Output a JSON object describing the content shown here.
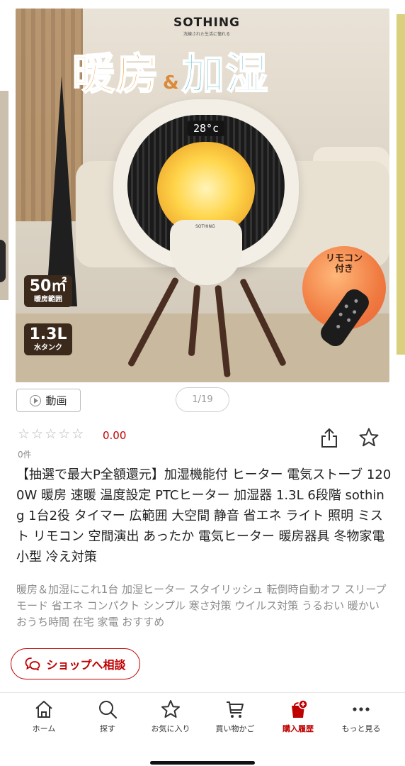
{
  "carousel": {
    "brand": "SOTHING",
    "brand_tagline": "洗練された生活に憧れる",
    "headline_a": "暖房",
    "headline_amp": "&",
    "headline_b": "加湿",
    "display_temp": "28°c",
    "heater_logo": "SOTHING",
    "badge_area_big": "50㎡",
    "badge_area_small": "暖房範囲",
    "badge_tank_big": "1.3L",
    "badge_tank_small": "水タンク",
    "remote_label_line1": "リモコン",
    "remote_label_line2": "付き",
    "video_label": "動画",
    "pager": "1/19"
  },
  "rating": {
    "stars_filled": 0,
    "stars_total": 5,
    "value": "0.00",
    "count": "0件"
  },
  "product": {
    "title": "【抽選で最大P全額還元】加湿機能付 ヒーター 電気ストーブ 1200W 暖房 速暖 温度設定 PTCヒーター 加湿器 1.3L 6段階 sothing 1台2役 タイマー 広範囲 大空間 静音 省エネ ライト 照明 ミスト リモコン 空間演出 あったか 電気ヒーター 暖房器具 冬物家電 小型 冷え対策",
    "description": "暖房＆加湿にこれ1台 加湿ヒーター スタイリッシュ 転倒時自動オフ スリープモード 省エネ コンパクト シンプル 寒さ対策 ウイルス対策 うるおい 暖かい おうち時間 在宅 家電 おすすめ"
  },
  "consult": {
    "label": "ショップへ相談"
  },
  "nav": {
    "items": [
      {
        "label": "ホーム",
        "icon": "home-icon"
      },
      {
        "label": "探す",
        "icon": "search-icon"
      },
      {
        "label": "お気に入り",
        "icon": "star-icon"
      },
      {
        "label": "買い物かご",
        "icon": "cart-icon"
      },
      {
        "label": "購入履歴",
        "icon": "purchase-history-icon"
      },
      {
        "label": "もっと見る",
        "icon": "more-icon"
      }
    ]
  },
  "colors": {
    "accent": "#bf0000",
    "muted": "#8d8d8d"
  }
}
